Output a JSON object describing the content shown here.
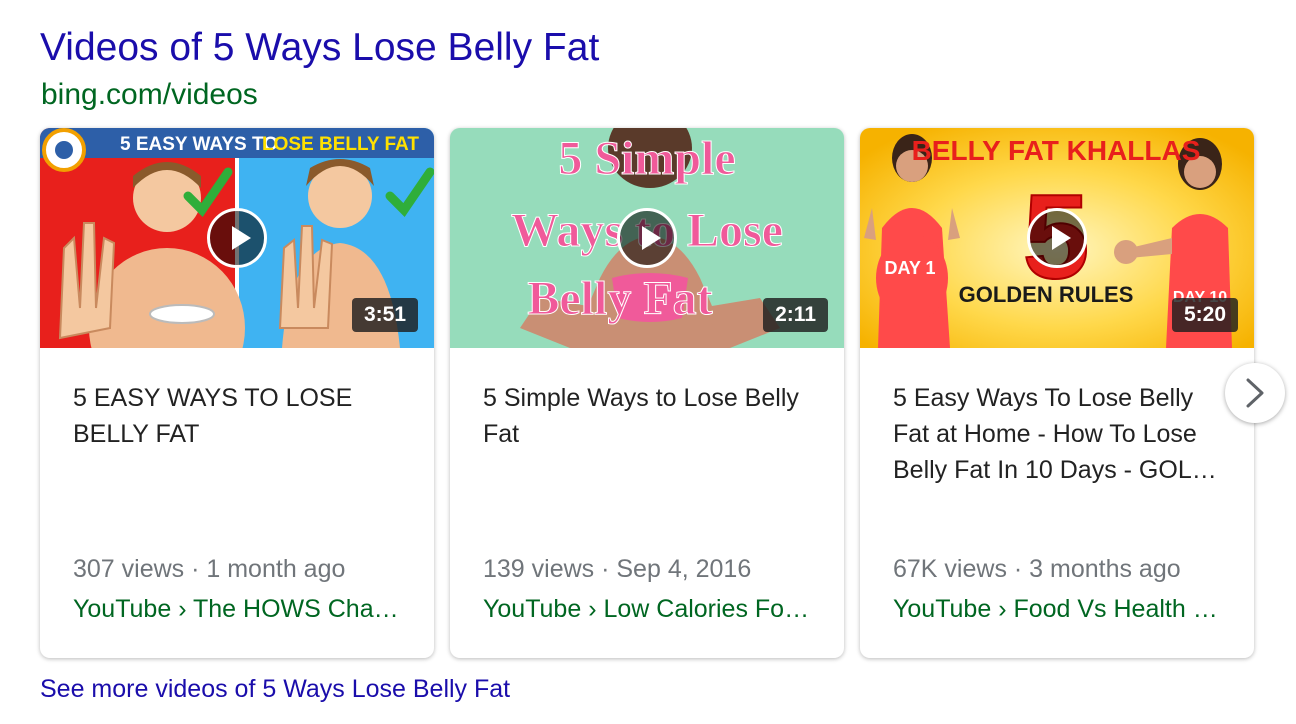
{
  "header": {
    "title": "Videos of 5 Ways Lose Belly Fat",
    "source": "bing.com/videos"
  },
  "videos": [
    {
      "duration": "3:51",
      "title": "5 EASY WAYS TO LOSE BELLY FAT",
      "meta": "307 views · 1 month ago",
      "channel": "YouTube › The HOWS Chan…",
      "thumb_text": [
        "5 EASY WAYS TO ",
        "LOSE BELLY FAT"
      ]
    },
    {
      "duration": "2:11",
      "title": "5 Simple Ways to Lose Belly Fat",
      "meta": "139 views · Sep 4, 2016",
      "channel": "YouTube › Low Calories Fo…",
      "thumb_text": [
        "5 Simple",
        "Ways to Lose",
        "Belly Fat"
      ]
    },
    {
      "duration": "5:20",
      "title": "5 Easy Ways To Lose Belly Fat at Home - How To Lose Belly Fat In 10 Days - GOL…",
      "meta": "67K views · 3 months ago",
      "channel": "YouTube › Food Vs Health …",
      "thumb_text": [
        "BELLY FAT KHALLAS",
        "5",
        "GOLDEN RULES",
        "DAY 1",
        "DAY 10"
      ]
    }
  ],
  "see_more": "See more videos of 5 Ways Lose Belly Fat",
  "icons": {
    "play": "play-icon",
    "next": "chevron-right-icon"
  },
  "colors": {
    "title_link": "#1a0dab",
    "source_green": "#006621",
    "meta_gray": "#70757a"
  }
}
